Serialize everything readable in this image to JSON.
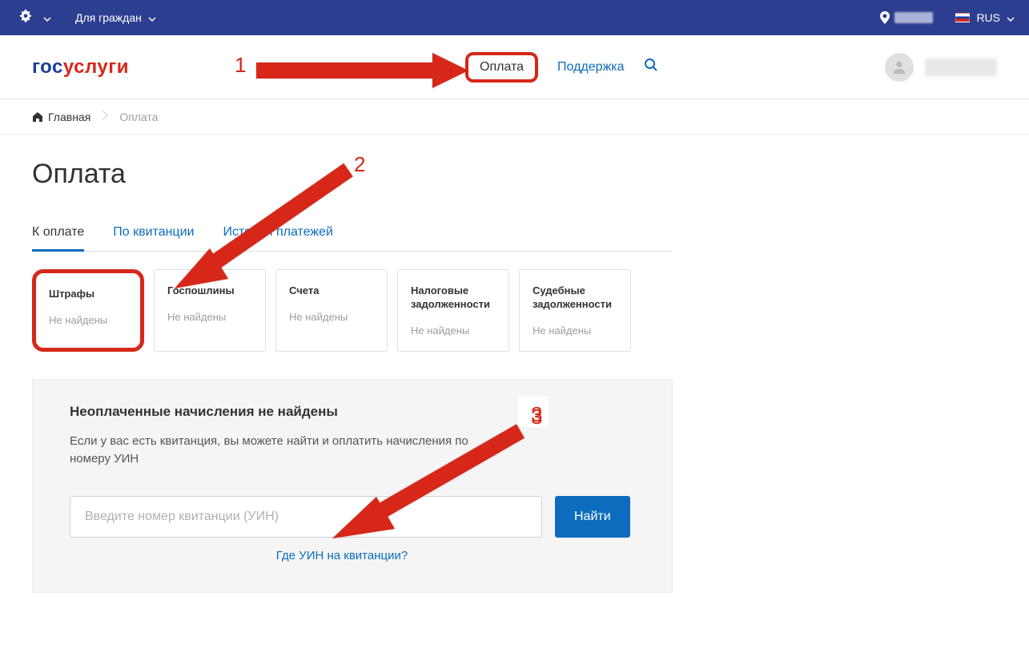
{
  "topbar": {
    "citizens_label": "Для граждан",
    "lang_label": "RUS"
  },
  "logo": {
    "gov": "гос",
    "serv": "услуги"
  },
  "nav": {
    "payment": "Оплата",
    "support": "Поддержка"
  },
  "breadcrumb": {
    "home": "Главная",
    "current": "Оплата"
  },
  "page": {
    "title": "Оплата"
  },
  "tabs": [
    {
      "label": "К оплате",
      "active": true
    },
    {
      "label": "По квитанции",
      "active": false
    },
    {
      "label": "История платежей",
      "active": false
    }
  ],
  "cards": [
    {
      "title": "Штрафы",
      "status": "Не найдены",
      "highlight": true
    },
    {
      "title": "Госпошлины",
      "status": "Не найдены",
      "highlight": false
    },
    {
      "title": "Счета",
      "status": "Не найдены",
      "highlight": false
    },
    {
      "title": "Налоговые задолженности",
      "status": "Не найдены",
      "highlight": false
    },
    {
      "title": "Судебные задолженности",
      "status": "Не найдены",
      "highlight": false
    }
  ],
  "panel": {
    "title": "Неоплаченные начисления не найдены",
    "desc": "Если у вас есть квитанция, вы можете найти и оплатить начисления по номеру УИН",
    "placeholder": "Введите номер квитанции (УИН)",
    "button": "Найти",
    "help": "Где УИН на квитанции?"
  },
  "annotations": {
    "n1": "1",
    "n2": "2",
    "n3": "3"
  }
}
